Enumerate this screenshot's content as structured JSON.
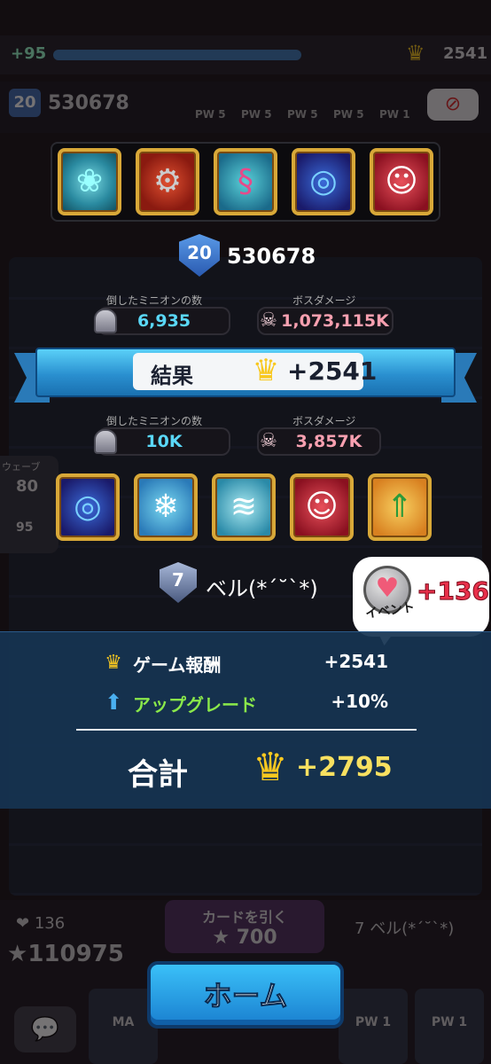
{
  "background": {
    "top_level": "+95",
    "top_crowns": "2541",
    "rank": "20",
    "score": "530678",
    "pw_labels": [
      "PW 5",
      "PW 5",
      "PW 5",
      "PW 5",
      "PW 1"
    ],
    "wave_label": "ウェーブ",
    "wave_num": "80",
    "wave_sub": "95",
    "hearts": "136",
    "stars": "110975",
    "draw_label": "カードを引く",
    "draw_cost": "700",
    "player_short": "ベル(*´˘`*)",
    "player_lvl": "7",
    "slot_labels": [
      "MA",
      "PW 1",
      "PW 1"
    ]
  },
  "opponent": {
    "cards": [
      "slime-icon",
      "gatling-icon",
      "dna-icon",
      "vortex-icon",
      "jester-icon"
    ],
    "rank": "20",
    "score": "530678",
    "minions_label": "倒したミニオンの数",
    "minions_value": "6,935",
    "boss_label": "ボスダメージ",
    "boss_value": "1,073,115K"
  },
  "result": {
    "label": "結果",
    "value": "+2541"
  },
  "player": {
    "minions_label": "倒したミニオンの数",
    "minions_value": "10K",
    "boss_label": "ボスダメージ",
    "boss_value": "3,857K",
    "cards": [
      "vortex-icon",
      "snowflake-icon",
      "wave-icon",
      "jester-icon",
      "upgrade-arrow-icon"
    ],
    "level": "7",
    "name": "ベル(*´˘`*)"
  },
  "event": {
    "label": "イベント",
    "value": "+136"
  },
  "summary": {
    "game_reward_label": "ゲーム報酬",
    "game_reward_value": "+2541",
    "upgrade_label": "アップグレード",
    "upgrade_value": "+10%",
    "total_label": "合計",
    "total_value": "+2795"
  },
  "home_button": "ホーム",
  "colors": {
    "accent_blue": "#2a90d0",
    "crown_gold": "#f8c820",
    "upgrade_green": "#8ae84a",
    "total_yellow": "#f8e060",
    "event_red": "#e8304a"
  }
}
